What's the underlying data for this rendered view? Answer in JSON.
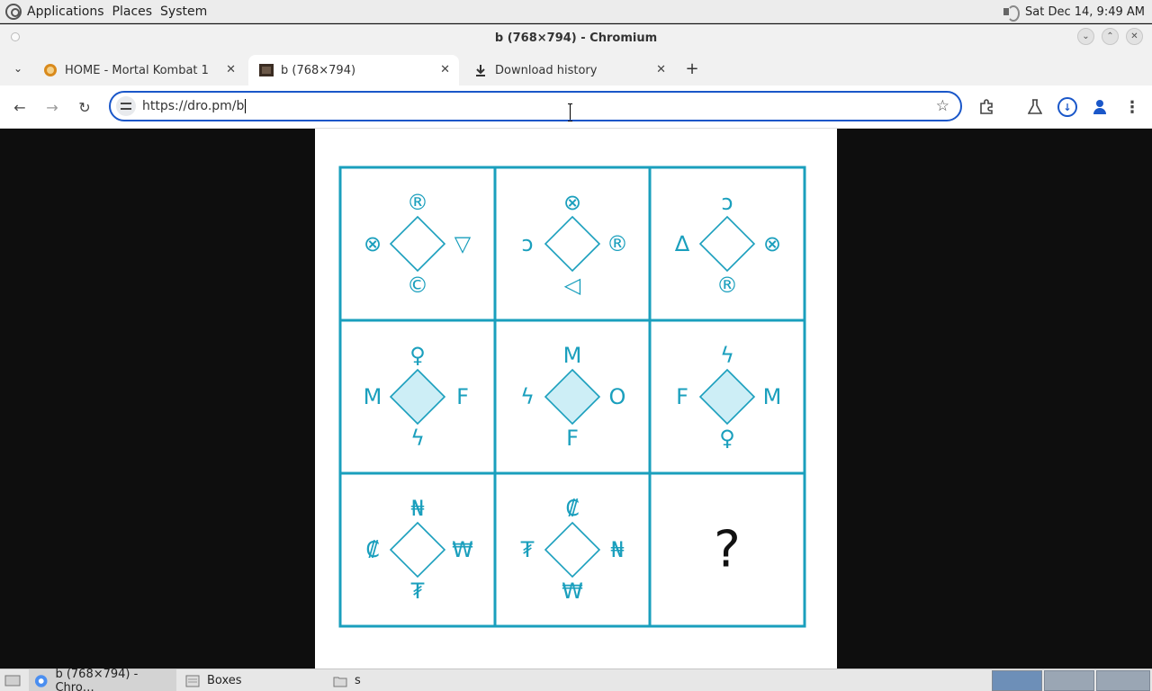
{
  "system_panel": {
    "menus": [
      "Applications",
      "Places",
      "System"
    ],
    "clock": "Sat Dec 14,  9:49 AM"
  },
  "window": {
    "title": "b (768×794) - Chromium"
  },
  "tabs": [
    {
      "label": "HOME - Mortal Kombat 1",
      "active": false,
      "icon": "mortal-kombat-favicon"
    },
    {
      "label": "b (768×794)",
      "active": true,
      "icon": "image-favicon"
    },
    {
      "label": "Download history",
      "active": false,
      "icon": "download-icon"
    }
  ],
  "toolbar": {
    "url": "https://dro.pm/b"
  },
  "puzzle": {
    "accent_color": "#1a9fbd",
    "cells": [
      {
        "top": "®",
        "left": "⊗",
        "right": "▽",
        "bottom": "©",
        "filled": false
      },
      {
        "top": "⊗",
        "left": "ↄ",
        "right": "®",
        "bottom": "◁",
        "filled": false
      },
      {
        "top": "ↄ",
        "left": "∆",
        "right": "⊗",
        "bottom": "®",
        "filled": false
      },
      {
        "top": "♀",
        "left": "M",
        "right": "F",
        "bottom": "ϟ",
        "filled": true
      },
      {
        "top": "M",
        "left": "ϟ",
        "right": "O",
        "bottom": "F",
        "filled": true
      },
      {
        "top": "ϟ",
        "left": "F",
        "right": "M",
        "bottom": "♀",
        "filled": true
      },
      {
        "top": "₦",
        "left": "₡",
        "right": "₩",
        "bottom": "₮",
        "filled": false
      },
      {
        "top": "₡",
        "left": "₮",
        "right": "₦",
        "bottom": "₩",
        "filled": false
      }
    ],
    "question_mark": "?"
  },
  "taskbar": {
    "items": [
      {
        "label": "b (768×794) - Chro…",
        "active": true
      },
      {
        "label": "Boxes",
        "active": false
      },
      {
        "label": "s",
        "active": false
      }
    ]
  }
}
